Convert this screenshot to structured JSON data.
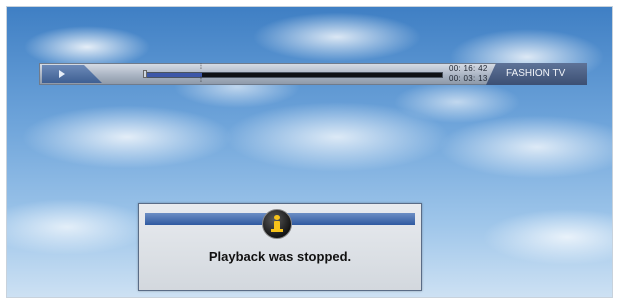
{
  "player": {
    "channel_name": "FASHION TV",
    "elapsed_time": "00: 16: 42",
    "total_time": "00: 03: 13",
    "progress": 0.19,
    "marker_glyph": "⁞",
    "icons": {
      "play": "play-icon"
    }
  },
  "dialog": {
    "message": "Playback was stopped.",
    "icon": "info-icon"
  },
  "colors": {
    "accent_blue": "#3d57a8",
    "channel_bg": "#4a5f85",
    "info_yellow": "#f6c21a"
  }
}
